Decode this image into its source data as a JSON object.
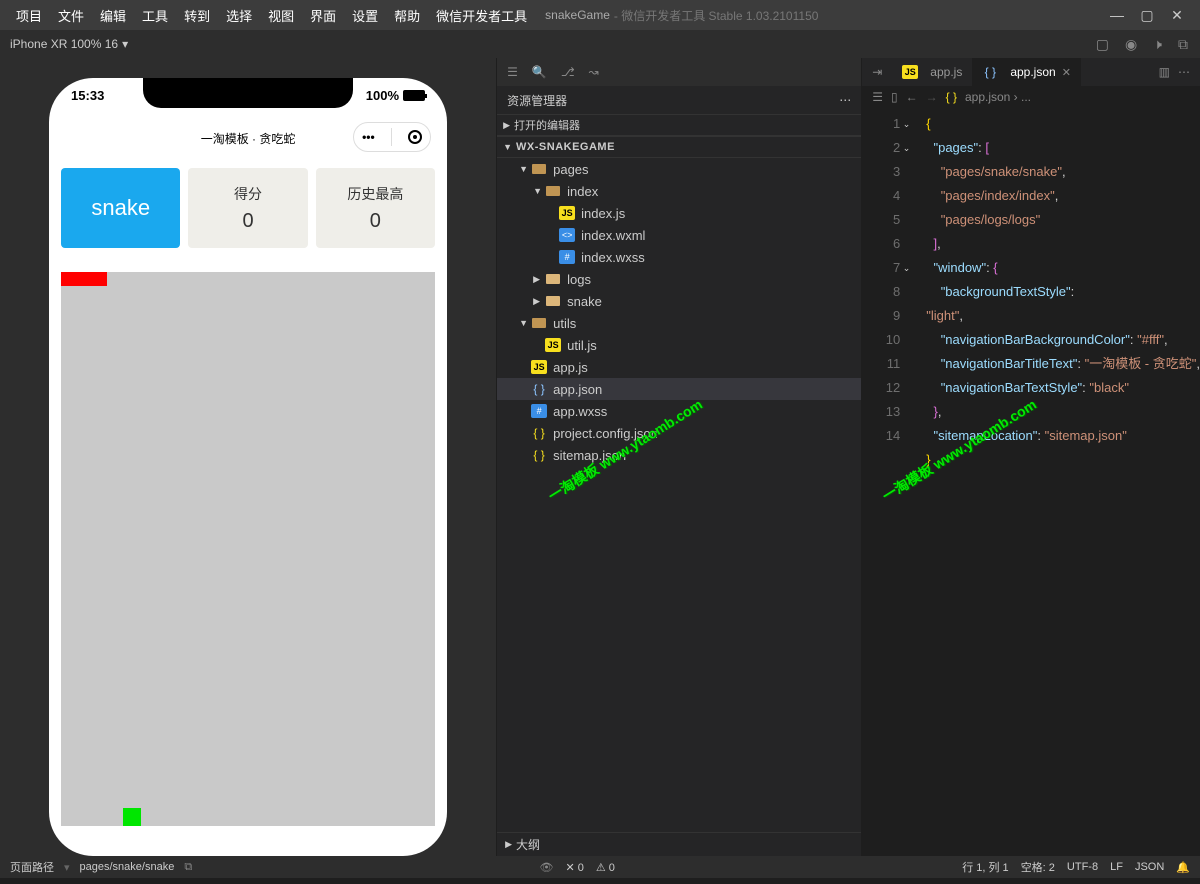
{
  "menu": {
    "items": [
      "项目",
      "文件",
      "编辑",
      "工具",
      "转到",
      "选择",
      "视图",
      "界面",
      "设置",
      "帮助",
      "微信开发者工具"
    ],
    "project": "snakeGame",
    "subtitle": "- 微信开发者工具 Stable 1.03.2101150"
  },
  "toolbar": {
    "device": "iPhone XR 100% 16",
    "arrow": "▾"
  },
  "sim": {
    "time": "15:33",
    "battery": "100%",
    "title": "一淘模板 · 贪吃蛇",
    "snake_btn": "snake",
    "score_lbl": "得分",
    "score_val": "0",
    "high_lbl": "历史最高",
    "high_val": "0"
  },
  "explorer": {
    "title": "资源管理器",
    "opened": "打开的编辑器",
    "project": "WX-SNAKEGAME",
    "tree": [
      {
        "n": "pages",
        "t": "folder",
        "d": 1,
        "open": true
      },
      {
        "n": "index",
        "t": "folder",
        "d": 2,
        "open": true
      },
      {
        "n": "index.js",
        "t": "js",
        "d": 3
      },
      {
        "n": "index.wxml",
        "t": "wxml",
        "d": 3
      },
      {
        "n": "index.wxss",
        "t": "wxss",
        "d": 3
      },
      {
        "n": "logs",
        "t": "folder",
        "d": 2
      },
      {
        "n": "snake",
        "t": "folder",
        "d": 2
      },
      {
        "n": "utils",
        "t": "folder",
        "d": 1,
        "open": true
      },
      {
        "n": "util.js",
        "t": "js",
        "d": 2
      },
      {
        "n": "app.js",
        "t": "js",
        "d": 1
      },
      {
        "n": "app.json",
        "t": "json",
        "d": 1,
        "sel": true
      },
      {
        "n": "app.wxss",
        "t": "wxss",
        "d": 1
      },
      {
        "n": "project.config.json",
        "t": "json",
        "d": 1
      },
      {
        "n": "sitemap.json",
        "t": "json",
        "d": 1
      }
    ],
    "outline": "大纲"
  },
  "editor": {
    "tabs": [
      {
        "name": "app.js",
        "icon": "js"
      },
      {
        "name": "app.json",
        "icon": "json",
        "active": true
      }
    ],
    "more_icons": [
      "▥",
      "⋯"
    ],
    "breadcrumb": "app.json › ...",
    "lines": [
      1,
      2,
      3,
      4,
      5,
      6,
      7,
      8,
      9,
      10,
      11,
      12,
      13,
      14
    ],
    "code_tokens": [
      [
        [
          "brace",
          "{"
        ]
      ],
      [
        [
          "sp",
          "  "
        ],
        [
          "key",
          "\"pages\""
        ],
        [
          "punc",
          ": "
        ],
        [
          "brack",
          "["
        ]
      ],
      [
        [
          "sp",
          "    "
        ],
        [
          "str",
          "\"pages/snake/snake\""
        ],
        [
          "punc",
          ","
        ]
      ],
      [
        [
          "sp",
          "    "
        ],
        [
          "str",
          "\"pages/index/index\""
        ],
        [
          "punc",
          ","
        ]
      ],
      [
        [
          "sp",
          "    "
        ],
        [
          "str",
          "\"pages/logs/logs\""
        ]
      ],
      [
        [
          "sp",
          "  "
        ],
        [
          "brack",
          "]"
        ],
        [
          "punc",
          ","
        ]
      ],
      [
        [
          "sp",
          "  "
        ],
        [
          "key",
          "\"window\""
        ],
        [
          "punc",
          ": "
        ],
        [
          "brack",
          "{"
        ]
      ],
      [
        [
          "sp",
          "    "
        ],
        [
          "key",
          "\"backgroundTextStyle\""
        ],
        [
          "punc",
          ": "
        ]
      ],
      [
        [
          "str",
          "\"light\""
        ],
        [
          "punc",
          ","
        ]
      ],
      [
        [
          "sp",
          "    "
        ],
        [
          "key",
          "\"navigationBarBackgroundColor\""
        ],
        [
          "punc",
          ": "
        ],
        [
          "str",
          "\"#fff\""
        ],
        [
          "punc",
          ","
        ]
      ],
      [
        [
          "sp",
          "    "
        ],
        [
          "key",
          "\"navigationBarTitleText\""
        ],
        [
          "punc",
          ": "
        ],
        [
          "str",
          "\"一淘模板 - 贪吃蛇\""
        ],
        [
          "punc",
          ","
        ]
      ],
      [
        [
          "sp",
          "    "
        ],
        [
          "key",
          "\"navigationBarTextStyle\""
        ],
        [
          "punc",
          ": "
        ],
        [
          "str",
          "\"black\""
        ]
      ],
      [
        [
          "sp",
          "  "
        ],
        [
          "brack",
          "}"
        ],
        [
          "punc",
          ","
        ]
      ],
      [
        [
          "sp",
          "  "
        ],
        [
          "key",
          "\"sitemapLocation\""
        ],
        [
          "punc",
          ": "
        ],
        [
          "str",
          "\"sitemap.json\""
        ]
      ],
      [
        [
          "brace",
          "}"
        ]
      ]
    ]
  },
  "statusbar": {
    "path_label": "页面路径",
    "path": "pages/snake/snake",
    "errors": "✕ 0",
    "warnings": "⚠ 0",
    "pos": "行 1, 列 1",
    "spaces": "空格: 2",
    "enc": "UTF-8",
    "eol": "LF",
    "lang": "JSON"
  },
  "watermark": "一淘模板 www.ytaomb.com"
}
